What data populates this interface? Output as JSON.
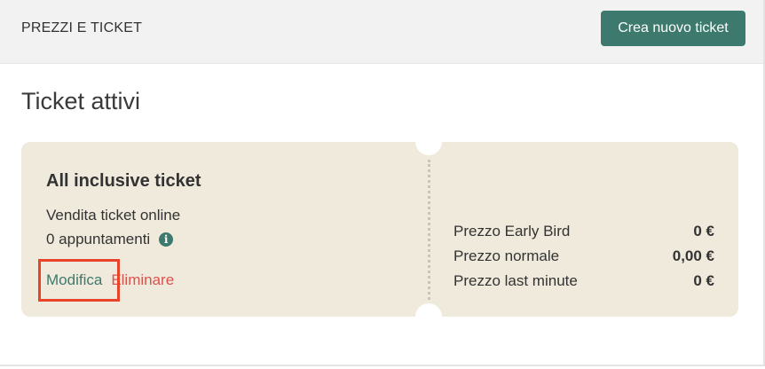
{
  "header": {
    "title": "PREZZI E TICKET",
    "create_button": "Crea nuovo ticket"
  },
  "section_title": "Ticket attivi",
  "ticket": {
    "name": "All inclusive ticket",
    "sale_mode": "Vendita ticket online",
    "appointments": "0 appuntamenti",
    "info_icon": "info-icon",
    "edit_label": "Modifica",
    "delete_label": "Eliminare",
    "prices": [
      {
        "label": "Prezzo Early Bird",
        "value": "0 €"
      },
      {
        "label": "Prezzo normale",
        "value": "0,00 €"
      },
      {
        "label": "Prezzo last minute",
        "value": "0 €"
      }
    ]
  },
  "colors": {
    "accent": "#3d7a6d",
    "danger": "#d9534f",
    "ticket_bg": "#efeadc",
    "highlight": "#e8442a"
  }
}
